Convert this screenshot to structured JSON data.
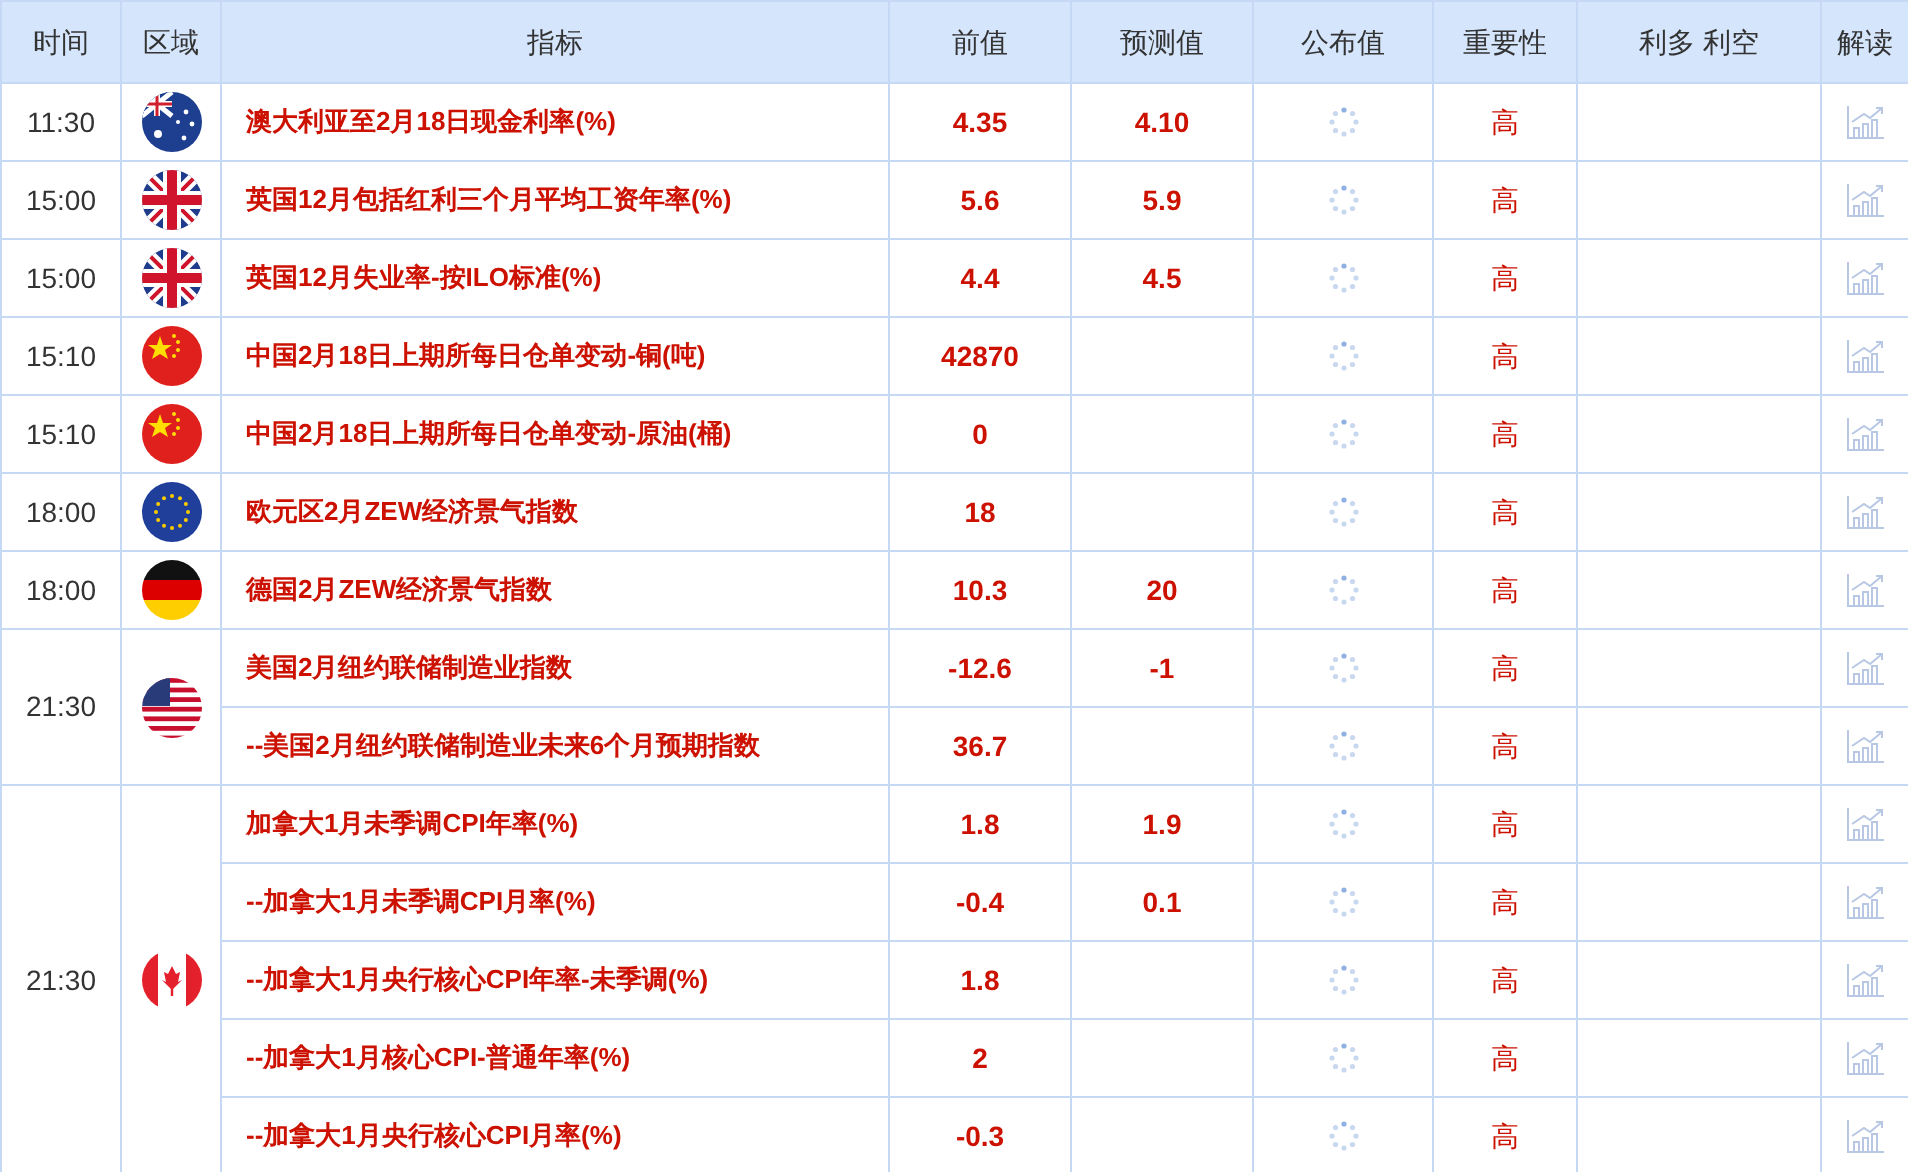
{
  "columns": [
    "时间",
    "区域",
    "指标",
    "前值",
    "预测值",
    "公布值",
    "重要性",
    "利多 利空",
    "解读"
  ],
  "groups": [
    {
      "time": "11:30",
      "kind": "au",
      "events": [
        {
          "name": "澳大利亚至2月18日现金利率(%)",
          "previous": "4.35",
          "forecast": "4.10",
          "importance": "高"
        }
      ]
    },
    {
      "time": "15:00",
      "kind": "gb",
      "events": [
        {
          "name": "英国12月包括红利三个月平均工资年率(%)",
          "previous": "5.6",
          "forecast": "5.9",
          "importance": "高"
        }
      ]
    },
    {
      "time": "15:00",
      "kind": "gb",
      "events": [
        {
          "name": "英国12月失业率-按ILO标准(%)",
          "previous": "4.4",
          "forecast": "4.5",
          "importance": "高"
        }
      ]
    },
    {
      "time": "15:10",
      "kind": "cn",
      "events": [
        {
          "name": "中国2月18日上期所每日仓单变动-铜(吨)",
          "previous": "42870",
          "importance": "高"
        }
      ]
    },
    {
      "time": "15:10",
      "kind": "cn",
      "events": [
        {
          "name": "中国2月18日上期所每日仓单变动-原油(桶)",
          "previous": "0",
          "importance": "高"
        }
      ]
    },
    {
      "time": "18:00",
      "kind": "eu",
      "events": [
        {
          "name": "欧元区2月ZEW经济景气指数",
          "previous": "18",
          "importance": "高"
        }
      ]
    },
    {
      "time": "18:00",
      "kind": "de",
      "events": [
        {
          "name": "德国2月ZEW经济景气指数",
          "previous": "10.3",
          "forecast": "20",
          "importance": "高"
        }
      ]
    },
    {
      "time": "21:30",
      "kind": "us",
      "events": [
        {
          "name": "美国2月纽约联储制造业指数",
          "previous": "-12.6",
          "forecast": "-1",
          "importance": "高"
        },
        {
          "name": "--美国2月纽约联储制造业未来6个月预期指数",
          "previous": "36.7",
          "importance": "高"
        }
      ]
    },
    {
      "time": "21:30",
      "kind": "ca",
      "events": [
        {
          "name": "加拿大1月未季调CPI年率(%)",
          "previous": "1.8",
          "forecast": "1.9",
          "importance": "高"
        },
        {
          "name": "--加拿大1月未季调CPI月率(%)",
          "previous": "-0.4",
          "forecast": "0.1",
          "importance": "高"
        },
        {
          "name": "--加拿大1月央行核心CPI年率-未季调(%)",
          "previous": "1.8",
          "importance": "高"
        },
        {
          "name": "--加拿大1月核心CPI-普通年率(%)",
          "previous": "2",
          "importance": "高"
        },
        {
          "name": "--加拿大1月央行核心CPI月率(%)",
          "previous": "-0.3",
          "importance": "高"
        }
      ]
    }
  ]
}
